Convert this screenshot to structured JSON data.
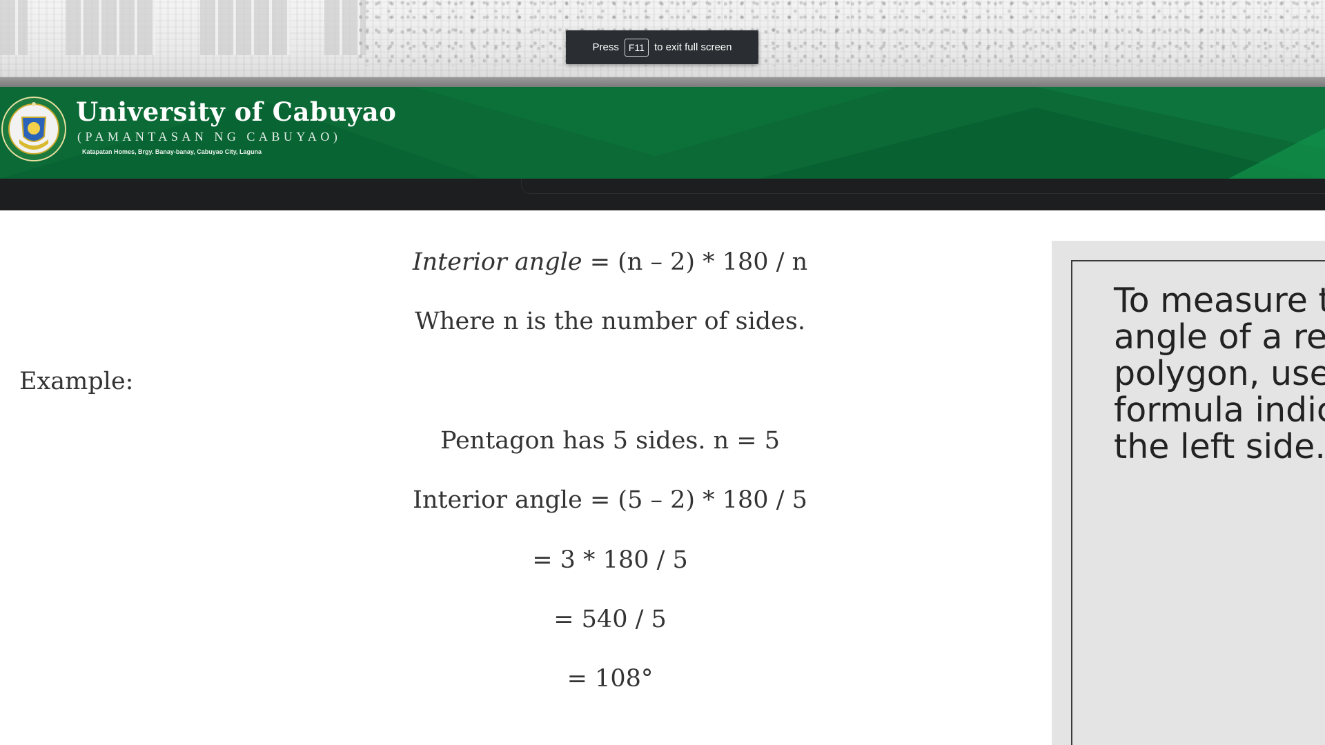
{
  "fullscreen_toast": {
    "press": "Press",
    "key": "F11",
    "message": "to exit full screen"
  },
  "banner": {
    "title": "University of Cabuyao",
    "subtitle": "(PAMANTASAN NG CABUYAO)",
    "address": "Katapatan Homes, Brgy. Banay-banay, Cabuyao City, Laguna",
    "colors": {
      "green": "#0b6a36",
      "nav": "#1d1e20"
    }
  },
  "content": {
    "formula_label": "Interior angle",
    "formula_rest": " = (n – 2) * 180 / n",
    "where_text": "Where n is the number of sides.",
    "example_label": "Example:",
    "pentagon_text": "Pentagon has 5 sides. n = 5",
    "step1": "Interior angle = (5 – 2) * 180 / 5",
    "step2": "= 3 * 180 / 5",
    "step3": "= 540 / 5",
    "step4": "= 108°"
  },
  "side_panel": {
    "text": "To measure t\nangle of a re\npolygon, use\nformula indic\nthe left side."
  }
}
